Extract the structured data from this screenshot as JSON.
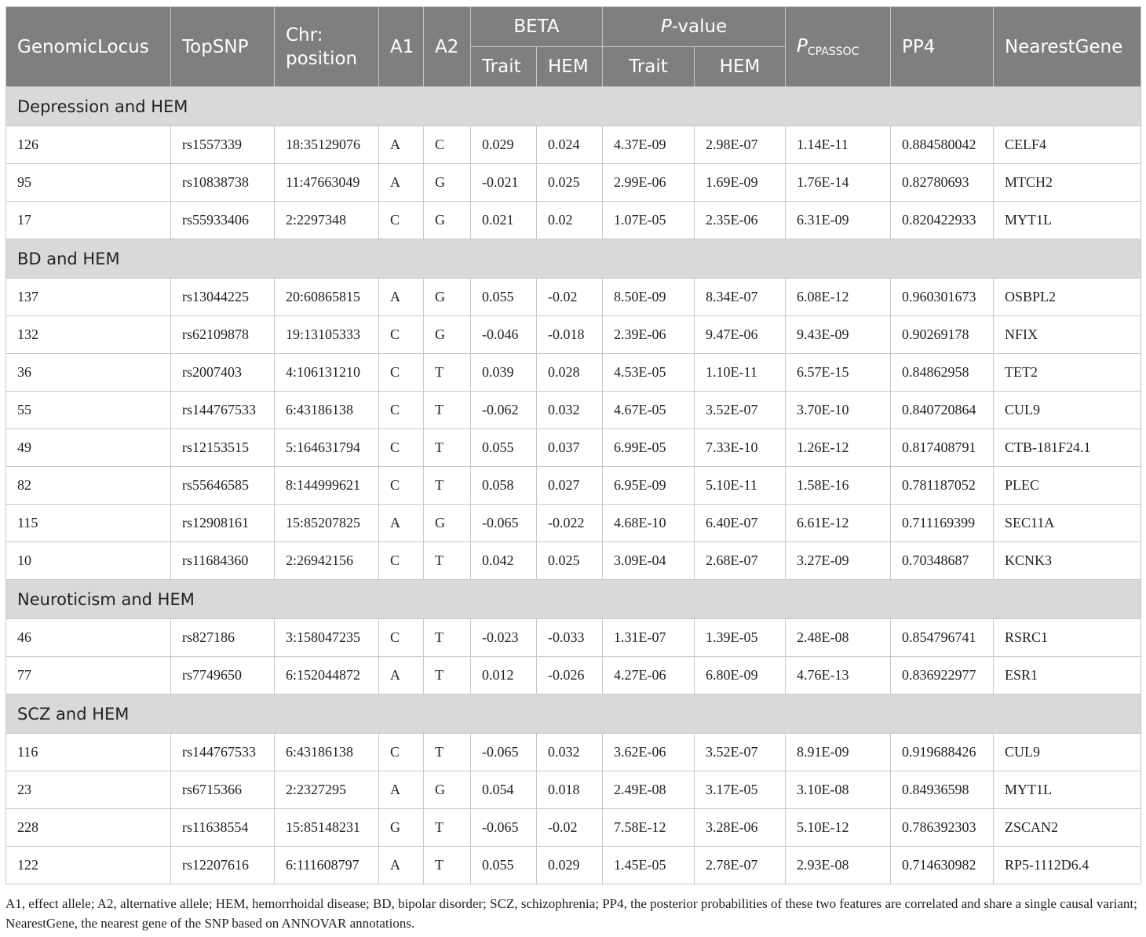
{
  "headers": {
    "genomic_locus": "GenomicLocus",
    "top_snp": "TopSNP",
    "chr_position": "Chr: position",
    "a1": "A1",
    "a2": "A2",
    "beta": "BETA",
    "p_value_italic": "P",
    "p_value_rest": "-value",
    "p_cpassoc_main": "P",
    "p_cpassoc_sub": "CPASSOC",
    "pp4": "PP4",
    "nearest_gene": "NearestGene",
    "trait": "Trait",
    "hem": "HEM"
  },
  "groups": [
    {
      "title": "Depression and HEM",
      "rows": [
        [
          "126",
          "rs1557339",
          "18:35129076",
          "A",
          "C",
          "0.029",
          "0.024",
          "4.37E-09",
          "2.98E-07",
          "1.14E-11",
          "0.884580042",
          "CELF4"
        ],
        [
          "95",
          "rs10838738",
          "11:47663049",
          "A",
          "G",
          "-0.021",
          "0.025",
          "2.99E-06",
          "1.69E-09",
          "1.76E-14",
          "0.82780693",
          "MTCH2"
        ],
        [
          "17",
          "rs55933406",
          "2:2297348",
          "C",
          "G",
          "0.021",
          "0.02",
          "1.07E-05",
          "2.35E-06",
          "6.31E-09",
          "0.820422933",
          "MYT1L"
        ]
      ]
    },
    {
      "title": "BD and HEM",
      "rows": [
        [
          "137",
          "rs13044225",
          "20:60865815",
          "A",
          "G",
          "0.055",
          "-0.02",
          "8.50E-09",
          "8.34E-07",
          "6.08E-12",
          "0.960301673",
          "OSBPL2"
        ],
        [
          "132",
          "rs62109878",
          "19:13105333",
          "C",
          "G",
          "-0.046",
          "-0.018",
          "2.39E-06",
          "9.47E-06",
          "9.43E-09",
          "0.90269178",
          "NFIX"
        ],
        [
          "36",
          "rs2007403",
          "4:106131210",
          "C",
          "T",
          "0.039",
          "0.028",
          "4.53E-05",
          "1.10E-11",
          "6.57E-15",
          "0.84862958",
          "TET2"
        ],
        [
          "55",
          "rs144767533",
          "6:43186138",
          "C",
          "T",
          "-0.062",
          "0.032",
          "4.67E-05",
          "3.52E-07",
          "3.70E-10",
          "0.840720864",
          "CUL9"
        ],
        [
          "49",
          "rs12153515",
          "5:164631794",
          "C",
          "T",
          "0.055",
          "0.037",
          "6.99E-05",
          "7.33E-10",
          "1.26E-12",
          "0.817408791",
          "CTB-181F24.1"
        ],
        [
          "82",
          "rs55646585",
          "8:144999621",
          "C",
          "T",
          "0.058",
          "0.027",
          "6.95E-09",
          "5.10E-11",
          "1.58E-16",
          "0.781187052",
          "PLEC"
        ],
        [
          "115",
          "rs12908161",
          "15:85207825",
          "A",
          "G",
          "-0.065",
          "-0.022",
          "4.68E-10",
          "6.40E-07",
          "6.61E-12",
          "0.711169399",
          "SEC11A"
        ],
        [
          "10",
          "rs11684360",
          "2:26942156",
          "C",
          "T",
          "0.042",
          "0.025",
          "3.09E-04",
          "2.68E-07",
          "3.27E-09",
          "0.70348687",
          "KCNK3"
        ]
      ]
    },
    {
      "title": "Neuroticism and HEM",
      "rows": [
        [
          "46",
          "rs827186",
          "3:158047235",
          "C",
          "T",
          "-0.023",
          "-0.033",
          "1.31E-07",
          "1.39E-05",
          "2.48E-08",
          "0.854796741",
          "RSRC1"
        ],
        [
          "77",
          "rs7749650",
          "6:152044872",
          "A",
          "T",
          "0.012",
          "-0.026",
          "4.27E-06",
          "6.80E-09",
          "4.76E-13",
          "0.836922977",
          "ESR1"
        ]
      ]
    },
    {
      "title": "SCZ and HEM",
      "rows": [
        [
          "116",
          "rs144767533",
          "6:43186138",
          "C",
          "T",
          "-0.065",
          "0.032",
          "3.62E-06",
          "3.52E-07",
          "8.91E-09",
          "0.919688426",
          "CUL9"
        ],
        [
          "23",
          "rs6715366",
          "2:2327295",
          "A",
          "G",
          "0.054",
          "0.018",
          "2.49E-08",
          "3.17E-05",
          "3.10E-08",
          "0.84936598",
          "MYT1L"
        ],
        [
          "228",
          "rs11638554",
          "15:85148231",
          "G",
          "T",
          "-0.065",
          "-0.02",
          "7.58E-12",
          "3.28E-06",
          "5.10E-12",
          "0.786392303",
          "ZSCAN2"
        ],
        [
          "122",
          "rs12207616",
          "6:111608797",
          "A",
          "T",
          "0.055",
          "0.029",
          "1.45E-05",
          "2.78E-07",
          "2.93E-08",
          "0.714630982",
          "RP5-1112D6.4"
        ]
      ]
    }
  ],
  "footnote": "A1, effect allele; A2, alternative allele; HEM, hemorrhoidal disease; BD, bipolar disorder; SCZ, schizophrenia; PP4, the posterior probabilities of these two features are correlated and share a single causal variant; NearestGene, the nearest gene of the SNP based on ANNOVAR annotations."
}
